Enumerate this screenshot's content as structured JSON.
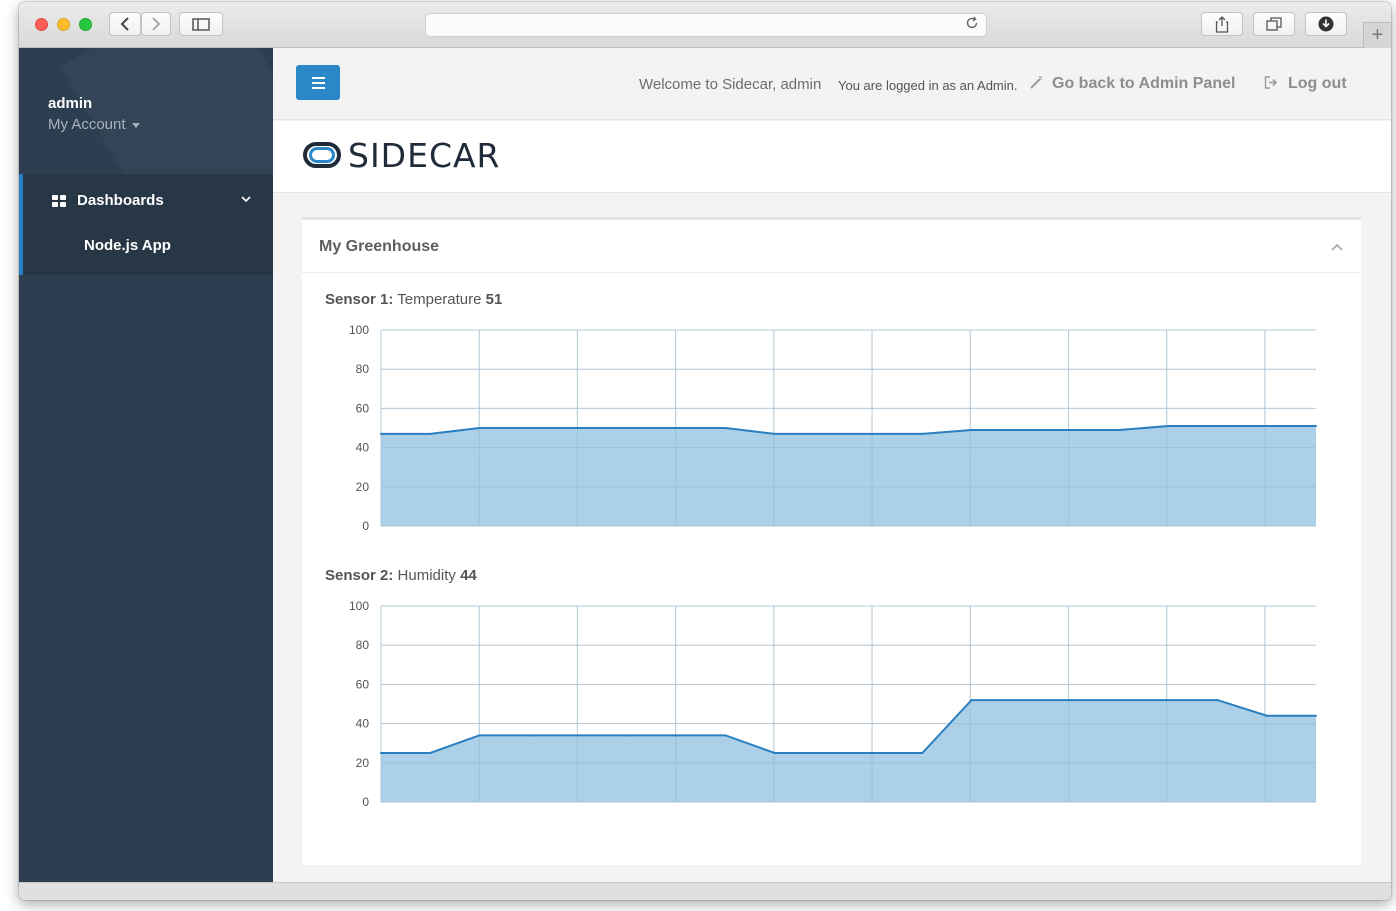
{
  "browser": {
    "url": "",
    "icons": [
      "back-icon",
      "forward-icon",
      "sidebar-icon",
      "reload-icon",
      "share-icon",
      "tabs-icon",
      "downloads-icon",
      "plus-icon"
    ],
    "new_tab_glyph": "+"
  },
  "sidebar": {
    "user_name": "admin",
    "account_label": "My Account",
    "nav": {
      "dashboards_label": "Dashboards",
      "sub_item_label": "Node.js App"
    }
  },
  "topbar": {
    "welcome": "Welcome to Sidecar, admin",
    "logged_in": "You are logged in as an Admin.",
    "admin_link": "Go back to Admin Panel",
    "logout": "Log out"
  },
  "brand": {
    "logo_text": "SIDECAR",
    "primary_color": "#1f2b39",
    "accent_color": "#2a87c8"
  },
  "panel": {
    "title": "My Greenhouse"
  },
  "colors": {
    "sidebar_bg": "#2c3e50",
    "area_fill": "#a6cde6",
    "area_line": "#2a7fc0",
    "grid": "#dcdcdc"
  },
  "chart_data": [
    {
      "type": "area",
      "label_prefix": "Sensor 1:",
      "label_name": "Temperature",
      "label_value": "51",
      "x": [
        0,
        1,
        2,
        3,
        4,
        5,
        6,
        7,
        8,
        9,
        10,
        11,
        12,
        13,
        14,
        15,
        16,
        17,
        18,
        19
      ],
      "values": [
        47,
        47,
        50,
        50,
        50,
        50,
        50,
        50,
        47,
        47,
        47,
        47,
        49,
        49,
        49,
        49,
        51,
        51,
        51,
        51
      ],
      "ylim": [
        0,
        100
      ],
      "yticks": [
        "100",
        "80",
        "60",
        "40",
        "20",
        "0"
      ],
      "grid": true,
      "vertical_gridlines": 10
    },
    {
      "type": "area",
      "label_prefix": "Sensor 2:",
      "label_name": "Humidity",
      "label_value": "44",
      "x": [
        0,
        1,
        2,
        3,
        4,
        5,
        6,
        7,
        8,
        9,
        10,
        11,
        12,
        13,
        14,
        15,
        16,
        17,
        18,
        19
      ],
      "values": [
        25,
        25,
        34,
        34,
        34,
        34,
        34,
        34,
        25,
        25,
        25,
        25,
        52,
        52,
        52,
        52,
        52,
        52,
        44,
        44
      ],
      "ylim": [
        0,
        100
      ],
      "yticks": [
        "100",
        "80",
        "60",
        "40",
        "20",
        "0"
      ],
      "grid": true,
      "vertical_gridlines": 10
    }
  ]
}
